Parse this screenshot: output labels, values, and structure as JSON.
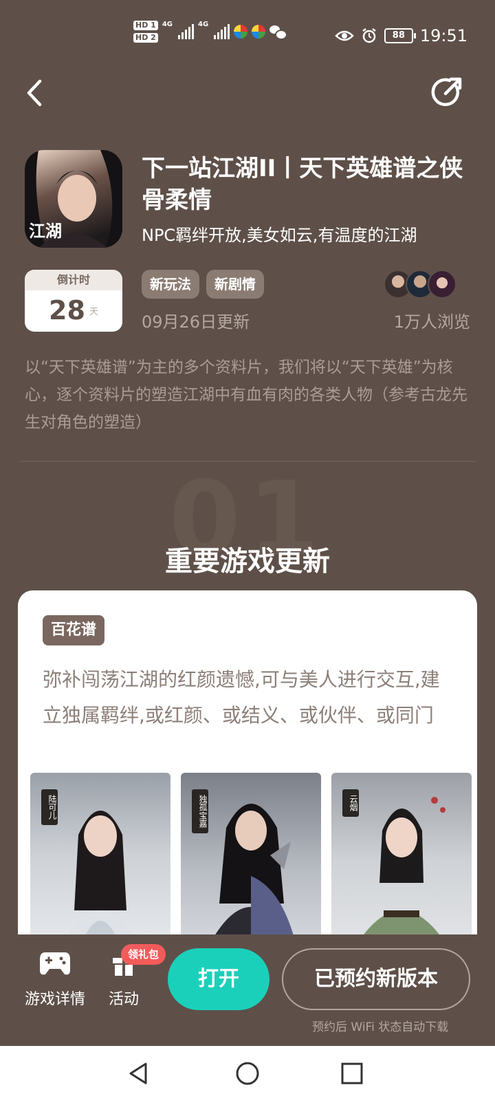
{
  "status_bar": {
    "sim1": "HD 1",
    "sim2": "HD 2",
    "network1": "4G",
    "network2": "4G",
    "battery": "88",
    "time": "19:51"
  },
  "nav": {
    "back_icon": "chevron-left-icon",
    "share_icon": "share-icon"
  },
  "header": {
    "app_icon_text": "江湖",
    "title": "下一站江湖II丨天下英雄谱之侠骨柔情",
    "subtitle": "NPC羁绊开放,美女如云,有温度的江湖",
    "countdown_label": "倒计时",
    "countdown_value": "28",
    "countdown_unit": "天",
    "tags": [
      "新玩法",
      "新剧情"
    ],
    "update_date": "09月26日更新",
    "views": "1万人浏览"
  },
  "description": "以“天下英雄谱”为主的多个资料片，我们将以“天下英雄”为核心，逐个资料片的塑造江湖中有血有肉的各类人物（参考古龙先生对角色的塑造）",
  "section": {
    "number": "01",
    "title": "重要游戏更新"
  },
  "card": {
    "tag": "百花谱",
    "text": "弥补闯荡江湖的红颜遗憾,可与美人进行交互,建立独属羁绊,或红颜、或结义、或伙伴、或同门",
    "portraits": [
      {
        "name": "陆可儿",
        "color": "#c9cdd2"
      },
      {
        "name": "独孤宝嘉",
        "color": "#5a5f8a"
      },
      {
        "name": "云烟",
        "color": "#7e9470"
      }
    ]
  },
  "action_bar": {
    "details_label": "游戏详情",
    "activity_label": "活动",
    "gift_badge": "领礼包",
    "open_label": "打开",
    "reserved_label": "已预约新版本",
    "wifi_note": "预约后 WiFi 状态自动下载"
  },
  "colors": {
    "background": "#5e5049",
    "accent": "#1bd0bb",
    "badge": "#f35b5b"
  }
}
